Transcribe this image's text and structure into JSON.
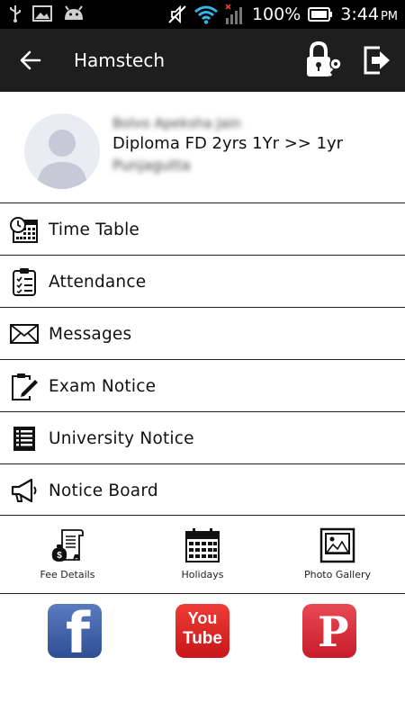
{
  "status_bar": {
    "battery_text": "100%",
    "time": "3:44",
    "ampm": "PM",
    "icons": [
      "usb-icon",
      "image-icon",
      "android-icon",
      "mute-icon",
      "wifi-icon",
      "signal-icon",
      "battery-icon"
    ]
  },
  "app_bar": {
    "title": "Hamstech",
    "actions": [
      "back-arrow-icon",
      "lock-key-icon",
      "logout-icon"
    ]
  },
  "profile": {
    "name": "Bolvo Apeksha Jain",
    "course": "Diploma FD 2yrs 1Yr >> 1yr",
    "branch": "Punjagutta"
  },
  "menu": [
    {
      "label": "Time Table",
      "icon": "timetable-icon"
    },
    {
      "label": "Attendance",
      "icon": "clipboard-checklist-icon"
    },
    {
      "label": "Messages",
      "icon": "envelope-icon"
    },
    {
      "label": "Exam Notice",
      "icon": "exam-pen-icon"
    },
    {
      "label": "University Notice",
      "icon": "list-icon"
    },
    {
      "label": "Notice Board",
      "icon": "megaphone-icon"
    }
  ],
  "quick_links": [
    {
      "label": "Fee Details",
      "icon": "fee-scroll-icon"
    },
    {
      "label": "Holidays",
      "icon": "calendar-icon"
    },
    {
      "label": "Photo Gallery",
      "icon": "photo-icon"
    }
  ],
  "social": {
    "facebook": "f",
    "youtube_top": "You",
    "youtube_bottom": "Tube",
    "pinterest": "P",
    "colors": {
      "facebook": "#3b5998",
      "youtube": "#e52d27",
      "pinterest": "#cb2027"
    }
  }
}
